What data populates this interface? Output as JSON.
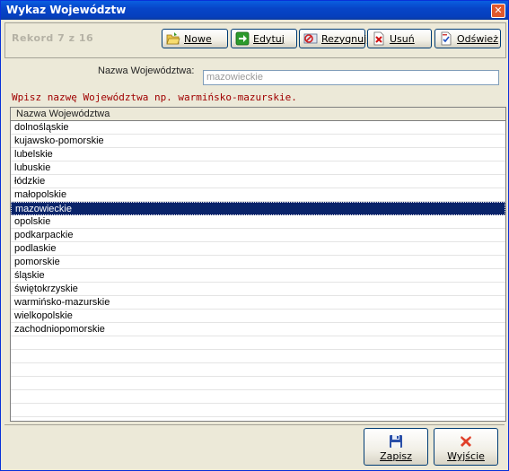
{
  "window": {
    "title": "Wykaz Województw",
    "close_glyph": "✕"
  },
  "toolbar": {
    "record_text": "Rekord 7 z 16",
    "buttons": {
      "new": {
        "label": "Nowe",
        "icon": "folder-open-icon"
      },
      "edit": {
        "label": "Edytuj",
        "icon": "arrow-right-icon"
      },
      "cancel": {
        "label": "Rezygnuj",
        "icon": "cancel-icon"
      },
      "delete": {
        "label": "Usuń",
        "icon": "delete-icon"
      },
      "refresh": {
        "label": "Odśwież",
        "icon": "refresh-icon"
      }
    }
  },
  "form": {
    "field_label": "Nazwa Województwa:",
    "field_value": "mazowieckie",
    "hint": "Wpisz nazwę Województwa np. warmińsko-mazurskie."
  },
  "grid": {
    "header": "Nazwa Województwa",
    "selected_index": 6,
    "rows": [
      "dolnośląskie",
      "kujawsko-pomorskie",
      "lubelskie",
      "lubuskie",
      "łódzkie",
      "małopolskie",
      "mazowieckie",
      "opolskie",
      "podkarpackie",
      "podlaskie",
      "pomorskie",
      "śląskie",
      "świętokrzyskie",
      "warmińsko-mazurskie",
      "wielkopolskie",
      "zachodniopomorskie",
      "",
      "",
      "",
      "",
      "",
      "",
      "",
      ""
    ]
  },
  "footer": {
    "save": {
      "label": "Zapisz",
      "icon": "floppy-disk-icon"
    },
    "exit": {
      "label": "Wyjście",
      "icon": "exit-x-icon"
    }
  },
  "colors": {
    "title_bar": "#0745c8",
    "selection": "#0a246a",
    "hint_text": "#a00000"
  }
}
